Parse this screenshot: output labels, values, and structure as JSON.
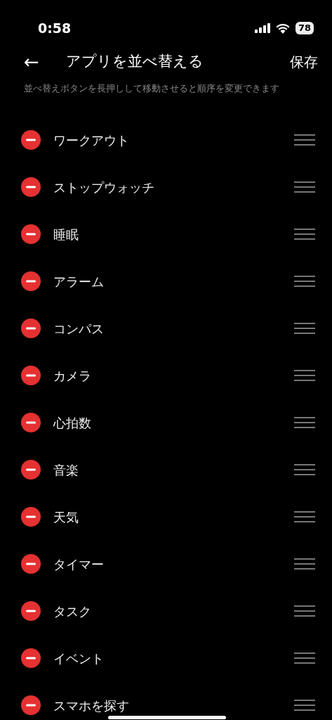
{
  "status_bar": {
    "time": "0:58",
    "battery": "78"
  },
  "header": {
    "back": "←",
    "title": "アプリを並べ替える",
    "action": "保存"
  },
  "description": "並べ替えボタンを長押しして移動させると順序を変更できます",
  "apps": [
    {
      "name": "ワークアウト"
    },
    {
      "name": "ストップウォッチ"
    },
    {
      "name": "睡眠"
    },
    {
      "name": "アラーム"
    },
    {
      "name": "コンパス"
    },
    {
      "name": "カメラ"
    },
    {
      "name": "心拍数"
    },
    {
      "name": "音楽"
    },
    {
      "name": "天気"
    },
    {
      "name": "タイマー"
    },
    {
      "name": "タスク"
    },
    {
      "name": "イベント"
    },
    {
      "name": "スマホを探す"
    }
  ]
}
